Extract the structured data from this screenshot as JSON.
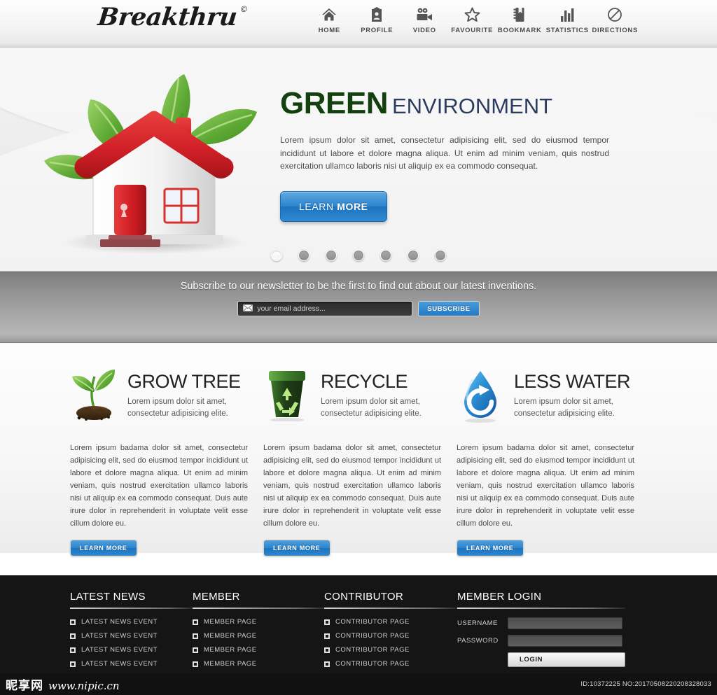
{
  "header": {
    "logo_text": "Breakthru",
    "logo_mark": "©",
    "nav": [
      {
        "label": "HOME",
        "icon": "home-icon"
      },
      {
        "label": "PROFILE",
        "icon": "profile-icon"
      },
      {
        "label": "VIDEO",
        "icon": "video-camera-icon"
      },
      {
        "label": "FAVOURITE",
        "icon": "star-icon"
      },
      {
        "label": "BOOKMARK",
        "icon": "bookmark-icon"
      },
      {
        "label": "STATISTICS",
        "icon": "bar-chart-icon"
      },
      {
        "label": "DIRECTIONS",
        "icon": "no-entry-icon"
      }
    ]
  },
  "hero": {
    "title_strong": "GREEN",
    "title_light": "ENVIRONMENT",
    "paragraph": "Lorem ipsum dolor sit amet, consectetur adipisicing elit, sed do eiusmod tempor incididunt ut labore et dolore magna aliqua. Ut enim ad minim veniam, quis nostrud exercitation ullamco laboris nisi ut aliquip ex ea commodo consequat.",
    "cta_light": "LEARN ",
    "cta_bold": "MORE",
    "slider_dots": 7,
    "slider_active_index": 0,
    "illustration": "green-house-with-leaves",
    "colors": {
      "green": "#12400f",
      "blue": "#2c3c5e",
      "button": "#2d86cf"
    }
  },
  "newsletter": {
    "headline": "Subscribe to our newsletter to be the first to find out about our latest inventions.",
    "email_placeholder": "your email address...",
    "email_value": "",
    "subscribe_label": "SUBSCRIBE"
  },
  "features": [
    {
      "icon": "seedling-icon",
      "title": "GROW TREE",
      "subtitle": "Lorem ipsum dolor sit amet, consectetur adipisicing elite.",
      "body": "Lorem ipsum badama dolor sit amet, consectetur adipisicing elit, sed do eiusmod tempor incididunt ut labore et dolore magna aliqua. Ut enim ad minim veniam, quis nostrud exercitation ullamco laboris nisi ut aliquip ex ea commodo consequat. Duis aute irure dolor in reprehenderit in voluptate velit esse cillum dolore eu.",
      "cta": "LEARN MORE"
    },
    {
      "icon": "recycle-bin-icon",
      "title": "RECYCLE",
      "subtitle": "Lorem ipsum dolor sit amet, consectetur adipisicing elite.",
      "body": "Lorem ipsum badama dolor sit amet, consectetur adipisicing elit, sed do eiusmod tempor incididunt ut labore et dolore magna aliqua. Ut enim ad minim veniam, quis nostrud exercitation ullamco laboris nisi ut aliquip ex ea commodo consequat. Duis aute irure dolor in reprehenderit in voluptate velit esse cillum dolore eu.",
      "cta": "LEARN MORE"
    },
    {
      "icon": "water-drop-refresh-icon",
      "title": "LESS WATER",
      "subtitle": "Lorem ipsum dolor sit amet, consectetur adipisicing elite.",
      "body": "Lorem ipsum badama dolor sit amet, consectetur adipisicing elit, sed do eiusmod tempor incididunt ut labore et dolore magna aliqua. Ut enim ad minim veniam, quis nostrud exercitation ullamco laboris nisi ut aliquip ex ea commodo consequat. Duis aute irure dolor in reprehenderit in voluptate velit esse cillum dolore eu.",
      "cta": "LEARN MORE"
    }
  ],
  "footer": {
    "columns": [
      {
        "title": "LATEST NEWS",
        "items": [
          "LATEST NEWS EVENT",
          "LATEST NEWS EVENT",
          "LATEST NEWS EVENT",
          "LATEST NEWS EVENT"
        ]
      },
      {
        "title": "MEMBER",
        "items": [
          "MEMBER PAGE",
          "MEMBER PAGE",
          "MEMBER PAGE",
          "MEMBER PAGE"
        ]
      },
      {
        "title": "CONTRIBUTOR",
        "items": [
          "CONTRIBUTOR PAGE",
          "CONTRIBUTOR PAGE",
          "CONTRIBUTOR PAGE",
          "CONTRIBUTOR PAGE"
        ]
      }
    ],
    "login": {
      "title": "MEMBER LOGIN",
      "username_label": "USERNAME",
      "username_value": "",
      "password_label": "PASSWORD",
      "password_value": "",
      "button_label": "LOGIN"
    }
  },
  "watermark": {
    "site_cn": "昵享网",
    "site_url": "www.nipic.cn",
    "id_text": "ID:10372225 NO:20170508220208328033"
  }
}
